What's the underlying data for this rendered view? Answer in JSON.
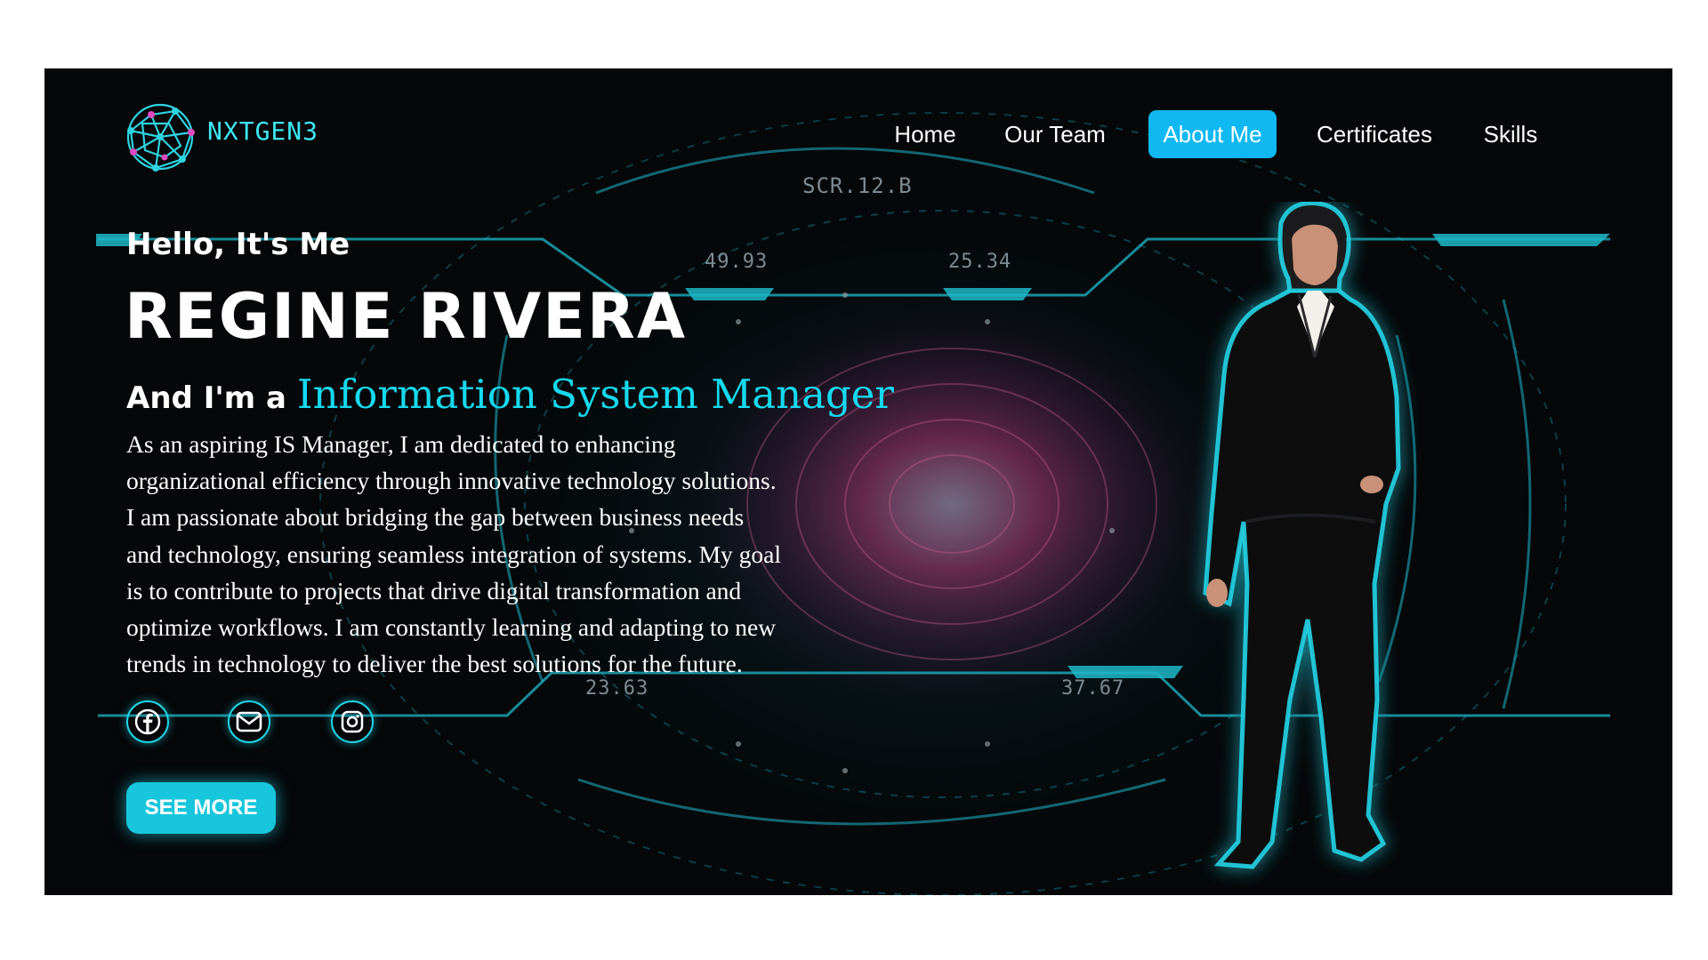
{
  "brand": {
    "name": "NXTGEN3",
    "logo_icon": "network-globe-icon"
  },
  "nav": {
    "items": [
      {
        "label": "Home",
        "active": false
      },
      {
        "label": "Our Team",
        "active": false
      },
      {
        "label": "About Me",
        "active": true
      },
      {
        "label": "Certificates",
        "active": false
      },
      {
        "label": "Skills",
        "active": false
      }
    ]
  },
  "hud": {
    "code": "SCR.12.B",
    "values": [
      "49.93",
      "25.34",
      "23.63",
      "37.67"
    ]
  },
  "hero": {
    "greeting": "Hello, It's Me",
    "name": "REGINE RIVERA",
    "role_prefix": "And I'm a",
    "role_highlight": "Information System Manager",
    "bio_lines": [
      "As an aspiring IS Manager, I am dedicated to enhancing",
      "organizational efficiency through innovative technology solutions.",
      "I am passionate about bridging the gap between business needs",
      "and technology, ensuring seamless integration of systems. My goal",
      "is to contribute to projects that drive digital transformation and",
      "optimize workflows. I am constantly learning and adapting to new",
      "trends in technology to deliver the best solutions for the future."
    ],
    "button_label": "SEE MORE"
  },
  "social": [
    {
      "icon": "facebook-icon"
    },
    {
      "icon": "mail-icon"
    },
    {
      "icon": "instagram-icon"
    }
  ],
  "colors": {
    "accent": "#16d9ee",
    "nav_active": "#10b8f2",
    "background": "#050709",
    "button": "#17c6dc"
  }
}
